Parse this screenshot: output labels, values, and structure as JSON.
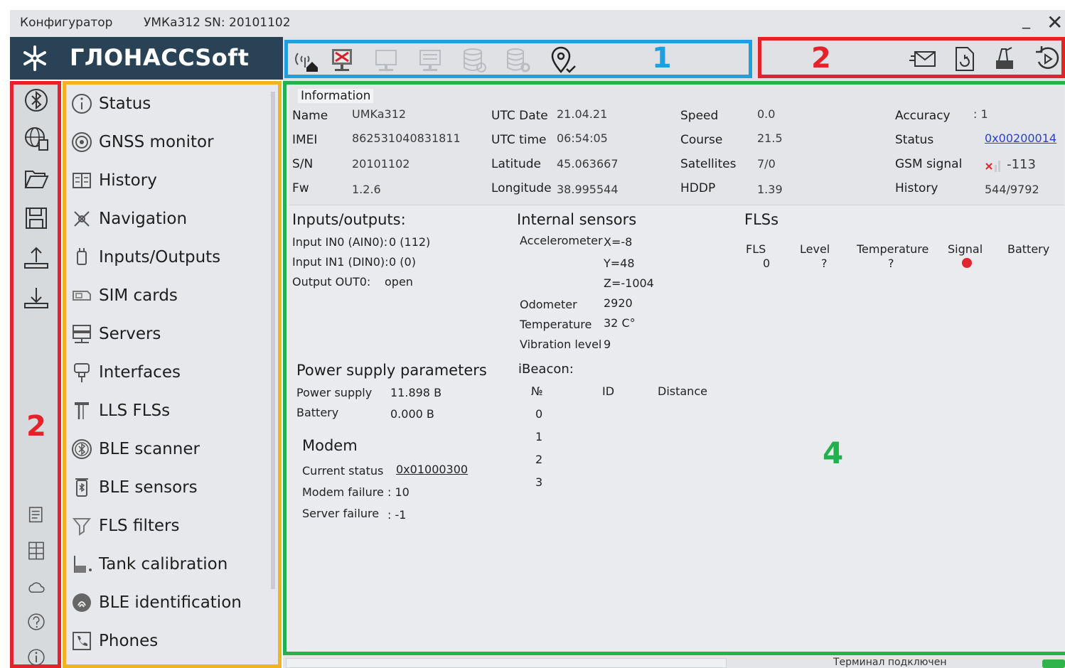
{
  "window": {
    "app_title": "Конфигуратор",
    "device_title": "УМКа312 SN: 20101102",
    "minimize_glyph": "_",
    "close_glyph": "✕"
  },
  "brand": {
    "name": "ГЛОНАССSoft",
    "icon": "snowflake-logo-icon"
  },
  "markers": {
    "toolbar": "1",
    "actions": "2",
    "iconbar": "2",
    "content": "4"
  },
  "toolbar": {
    "tools": [
      {
        "icon": "connection-antenna-icon",
        "enabled": true
      },
      {
        "icon": "disconnect-device-icon",
        "enabled": true
      },
      {
        "icon": "device-read-icon",
        "enabled": false
      },
      {
        "icon": "device-write-icon",
        "enabled": false
      },
      {
        "icon": "database-icon",
        "enabled": false
      },
      {
        "icon": "database-settings-icon",
        "enabled": false
      },
      {
        "icon": "location-check-icon",
        "enabled": true
      }
    ],
    "actions": [
      {
        "icon": "send-sms-icon"
      },
      {
        "icon": "file-refresh-icon"
      },
      {
        "icon": "firmware-update-icon"
      },
      {
        "icon": "reset-icon"
      }
    ]
  },
  "iconbar": [
    {
      "icon": "bluetooth-icon"
    },
    {
      "icon": "globe-device-icon"
    },
    {
      "icon": "folder-open-icon"
    },
    {
      "icon": "save-icon"
    },
    {
      "icon": "upload-icon"
    },
    {
      "icon": "download-icon"
    },
    {
      "icon": "notes-icon"
    },
    {
      "icon": "calculator-icon"
    },
    {
      "icon": "cloud-icon"
    },
    {
      "icon": "help-icon"
    },
    {
      "icon": "info-icon"
    }
  ],
  "menu": [
    {
      "label": "Status",
      "icon": "info-circle-icon"
    },
    {
      "label": "GNSS monitor",
      "icon": "satellite-icon"
    },
    {
      "label": "History",
      "icon": "history-icon"
    },
    {
      "label": "Navigation",
      "icon": "navigation-icon"
    },
    {
      "label": "Inputs/Outputs",
      "icon": "plug-icon"
    },
    {
      "label": "SIM cards",
      "icon": "sim-card-icon"
    },
    {
      "label": "Servers",
      "icon": "server-icon"
    },
    {
      "label": "Interfaces",
      "icon": "interface-icon"
    },
    {
      "label": "LLS FLSs",
      "icon": "fuel-sensor-icon"
    },
    {
      "label": "BLE scanner",
      "icon": "ble-scanner-icon"
    },
    {
      "label": "BLE sensors",
      "icon": "ble-sensor-icon"
    },
    {
      "label": "FLS filters",
      "icon": "filter-icon"
    },
    {
      "label": "Tank calibration",
      "icon": "tank-icon"
    },
    {
      "label": "BLE identification",
      "icon": "ble-id-icon"
    },
    {
      "label": "Phones",
      "icon": "phone-icon"
    }
  ],
  "information": {
    "title": "Information",
    "col1": [
      {
        "label": "Name",
        "value": "UMKa312"
      },
      {
        "label": "IMEI",
        "value": "862531040831811"
      },
      {
        "label": "S/N",
        "value": "20101102"
      },
      {
        "label": "Fw",
        "value": "1.2.6"
      }
    ],
    "col2": [
      {
        "label": "UTC Date",
        "value": "21.04.21"
      },
      {
        "label": "UTC time",
        "value": "06:54:05"
      },
      {
        "label": "Latitude",
        "value": "45.063667"
      },
      {
        "label": "Longitude",
        "value": "38.995544"
      }
    ],
    "col3": [
      {
        "label": "Speed",
        "value": "0.0"
      },
      {
        "label": "Course",
        "value": "21.5"
      },
      {
        "label": "Satellites",
        "value": "7/0"
      },
      {
        "label": "HDDP",
        "value": "1.39"
      }
    ],
    "col4": [
      {
        "label": "Accuracy",
        "value": ": 1"
      },
      {
        "label": "Status",
        "value": "0x00200014"
      },
      {
        "label": "GSM signal",
        "value": "-113"
      },
      {
        "label": "History",
        "value": "544/9792"
      }
    ]
  },
  "io": {
    "title": "Inputs/outputs:",
    "rows": [
      {
        "label": "Input IN0 (AIN0):",
        "value": "0 (112)"
      },
      {
        "label": "Input IN1 (DIN0):",
        "value": "0 (0)"
      },
      {
        "label": "Output OUT0:",
        "value": "open"
      }
    ]
  },
  "internal": {
    "title": "Internal sensors",
    "accel_label": "Accelerometer",
    "accel": [
      "X=-8",
      "Y=48",
      "Z=-1004"
    ],
    "rows": [
      {
        "label": "Odometer",
        "value": "2920"
      },
      {
        "label": "Temperature",
        "value": "32 C°"
      },
      {
        "label": "Vibration level",
        "value": "9"
      }
    ]
  },
  "flss": {
    "title": "FLSs",
    "headers": [
      "FLS",
      "Level",
      "Temperature",
      "Signal",
      "Battery"
    ],
    "row": {
      "fls": "0",
      "level": "?",
      "temperature": "?"
    },
    "signal_color": "#e0262e"
  },
  "power": {
    "title": "Power supply parameters",
    "rows": [
      {
        "label": "Power supply",
        "value": "11.898 В"
      },
      {
        "label": "Battery",
        "value": "0.000 В"
      }
    ]
  },
  "modem": {
    "title": "Modem",
    "rows": [
      {
        "label": "Current status",
        "value": "0x01000300"
      },
      {
        "label": "Modem failure",
        "value": ": 10"
      },
      {
        "label": "Server failure",
        "value": ": -1"
      }
    ]
  },
  "ibeacon": {
    "title": "iBeacon:",
    "headers": [
      "№",
      "ID",
      "Distance"
    ],
    "rows": [
      "0",
      "1",
      "2",
      "3"
    ]
  },
  "statusbar": {
    "message": "Терминал подключен"
  },
  "colors": {
    "brand_bg": "#2a4256",
    "frame_blue": "#1f9fe0",
    "frame_red": "#e3232c",
    "frame_yellow": "#f0b323",
    "frame_green": "#22b14c",
    "link": "#2a3fd0"
  }
}
